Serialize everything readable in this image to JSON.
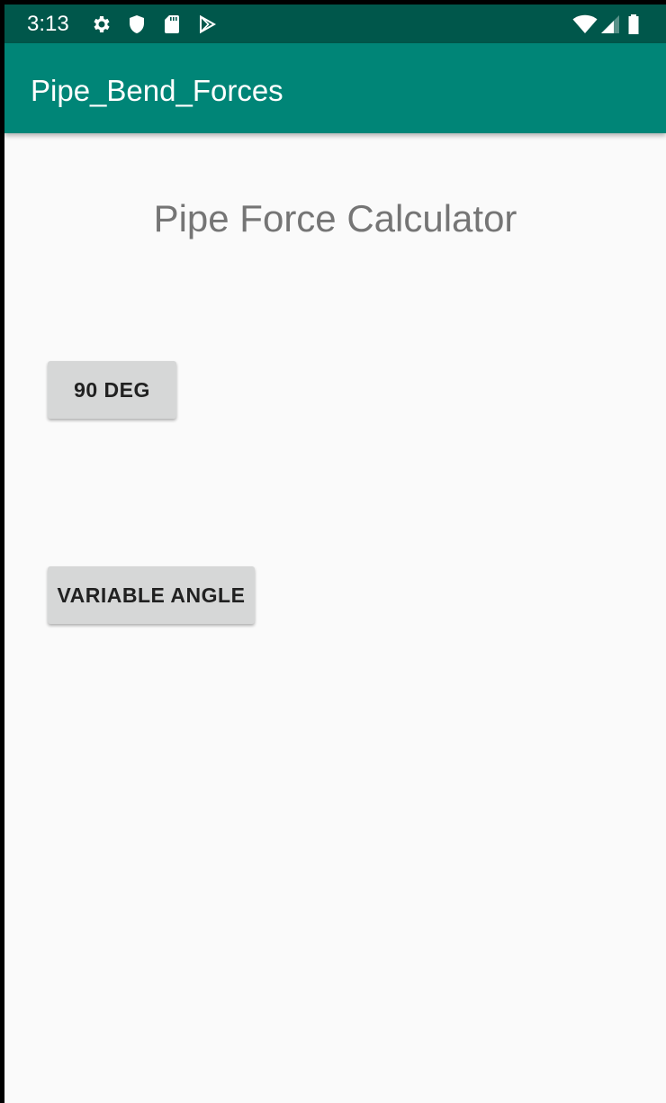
{
  "status_bar": {
    "time": "3:13",
    "left_icons": [
      "gear-icon",
      "shield-icon",
      "sd-card-icon",
      "play-store-icon"
    ],
    "right_icons": [
      "wifi-icon",
      "cellular-signal-icon",
      "battery-icon"
    ],
    "background": "#00574b"
  },
  "app_bar": {
    "title": "Pipe_Bend_Forces",
    "background": "#008577"
  },
  "main": {
    "heading": "Pipe Force Calculator",
    "buttons": {
      "deg90_label": "90 DEG",
      "variable_angle_label": "VARIABLE ANGLE"
    }
  },
  "colors": {
    "page_background": "#fafafa",
    "heading_text": "#757575",
    "button_background": "#d6d7d7",
    "button_text": "#212121"
  }
}
